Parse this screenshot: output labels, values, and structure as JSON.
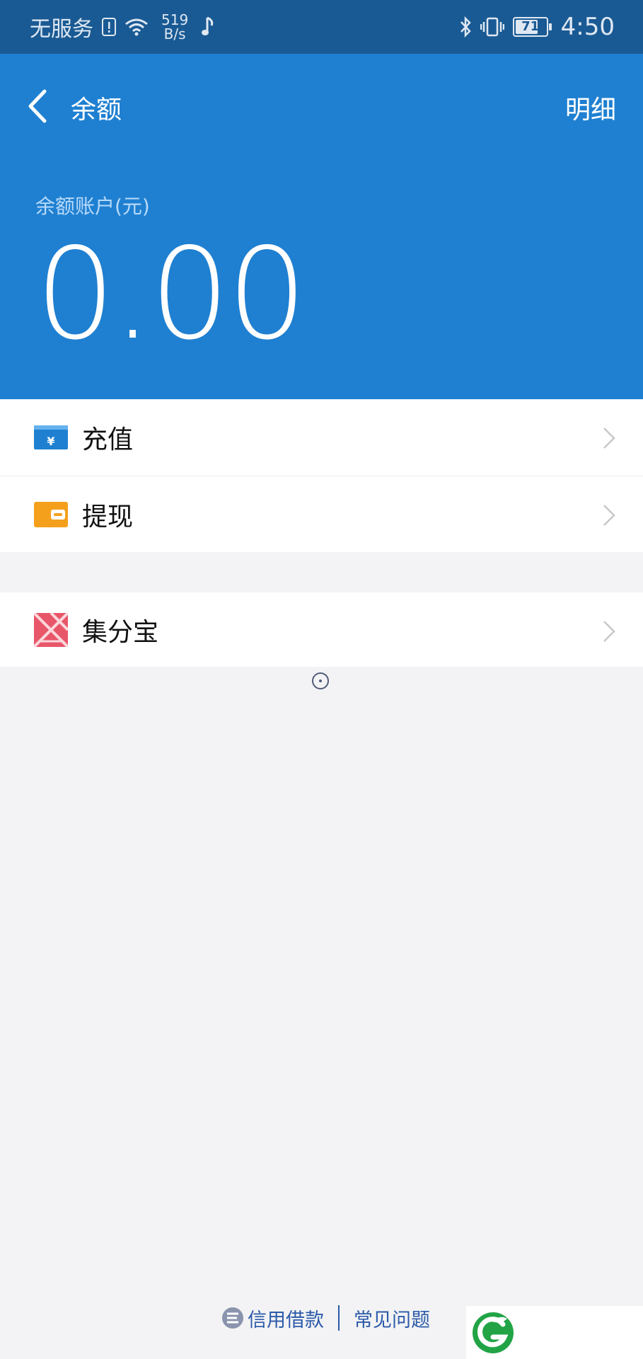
{
  "status_bar": {
    "carrier": "无服务",
    "net_speed_value": "519",
    "net_speed_unit": "B/s",
    "battery": "71",
    "time": "4:50"
  },
  "header": {
    "title": "余额",
    "detail_link": "明细"
  },
  "balance": {
    "label": "余额账户(元)",
    "amount": "0.00"
  },
  "menu_groups": [
    {
      "items": [
        {
          "label": "充值",
          "icon": "recharge-icon"
        },
        {
          "label": "提现",
          "icon": "wallet-icon"
        }
      ]
    },
    {
      "items": [
        {
          "label": "集分宝",
          "icon": "jifenbao-icon"
        }
      ]
    }
  ],
  "footer": {
    "credit_loan": "信用借款",
    "faq": "常见问题"
  },
  "colors": {
    "status_bar": "#1a5a94",
    "header": "#1f80d1",
    "recharge_icon": "#1f80d1",
    "wallet_icon": "#f4a01c",
    "jifenbao_icon": "#e8566a",
    "footer_link": "#2b5aa8",
    "watermark_logo": "#22a446"
  }
}
